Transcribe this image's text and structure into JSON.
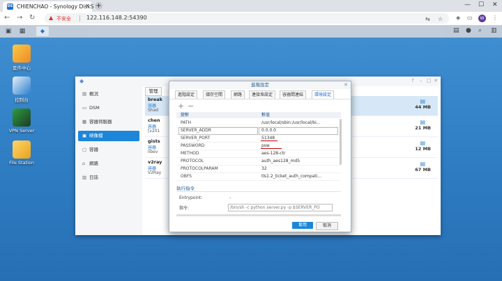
{
  "browser": {
    "tab_title": "CHIENCHAO - Synology DiskS",
    "favicon_text": "DS",
    "insecure_label": "不安全",
    "url": "122.116.148.2:54390",
    "avatar_letter": "W"
  },
  "desktop": {
    "icons": [
      {
        "label": "套件中心"
      },
      {
        "label": "控制台"
      },
      {
        "label": "VPN Server"
      },
      {
        "label": "File Station"
      }
    ]
  },
  "docker": {
    "sidebar": [
      {
        "label": "概況"
      },
      {
        "label": "DSM"
      },
      {
        "label": "容器伺服器"
      },
      {
        "label": "映像檔"
      },
      {
        "label": "容器"
      },
      {
        "label": "網路"
      },
      {
        "label": "日誌"
      }
    ],
    "manage_label": "管理",
    "rows": [
      {
        "name": "break",
        "status": "容器",
        "desc": "Shad",
        "size": "44 MB"
      },
      {
        "name": "chen",
        "status": "容器",
        "desc": "[v201",
        "size": "21 MB"
      },
      {
        "name": "gists",
        "status": "容器",
        "desc": "libev",
        "size": "12 MB"
      },
      {
        "name": "v2ray",
        "status": "容器",
        "desc": "V2Ray",
        "size": "67 MB"
      }
    ]
  },
  "dialog": {
    "title": "進階設定",
    "tabs": [
      "進階設定",
      "儲存空間",
      "網路",
      "連接埠設定",
      "容器間連結",
      "環境設定"
    ],
    "col_key": "變數",
    "col_value": "數值",
    "env": [
      {
        "key": "PATH",
        "value": "/usr/local/sbin:/usr/local/bi..."
      },
      {
        "key": "SERVER_ADDR",
        "value": "0.0.0.0"
      },
      {
        "key": "SERVER_PORT",
        "value": "51348"
      },
      {
        "key": "PASSWORD",
        "value": "psw"
      },
      {
        "key": "METHOD",
        "value": "aes-128-ctr"
      },
      {
        "key": "PROTOCOL",
        "value": "auth_aes128_md5"
      },
      {
        "key": "PROTOCOLPARAM",
        "value": "32"
      },
      {
        "key": "OBFS",
        "value": "tls1.2_ticket_auth_compati..."
      }
    ],
    "exec_section": "執行指令",
    "entrypoint_label": "Entrypoint:",
    "entrypoint_value": "-",
    "cmd_label": "指令:",
    "cmd_value": "/bin/sh -c python server.py -p $SERVER_PO",
    "ok_label": "套用",
    "cancel_label": "取消"
  }
}
